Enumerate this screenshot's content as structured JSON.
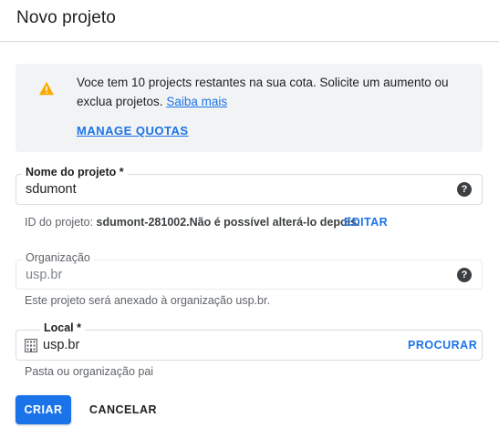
{
  "header": {
    "title": "Novo projeto"
  },
  "quota": {
    "message": "Voce tem 10 projects restantes na sua cota. Solicite um aumento ou exclua projetos.",
    "learn_more": "Saiba mais",
    "manage_label": "MANAGE QUOTAS",
    "icon": "warning-icon",
    "icon_color": "#f9ab00"
  },
  "project_name": {
    "label": "Nome do projeto *",
    "value": "sdumont",
    "help_icon": "help-icon"
  },
  "project_id": {
    "prefix": "ID do projeto:",
    "value": "sdumont-281002.",
    "suffix": "Não é possível alterá-lo depois.",
    "edit_label": "EDITAR"
  },
  "organization": {
    "label": "Organização",
    "value": "usp.br",
    "hint": "Este projeto será anexado à organização usp.br."
  },
  "location": {
    "label": "Local *",
    "value": "usp.br",
    "browse_label": "PROCURAR",
    "hint": "Pasta ou organização pai",
    "icon": "building-icon"
  },
  "actions": {
    "create_label": "CRIAR",
    "cancel_label": "CANCELAR"
  },
  "colors": {
    "accent": "#1a73e8",
    "warning": "#f9ab00"
  }
}
